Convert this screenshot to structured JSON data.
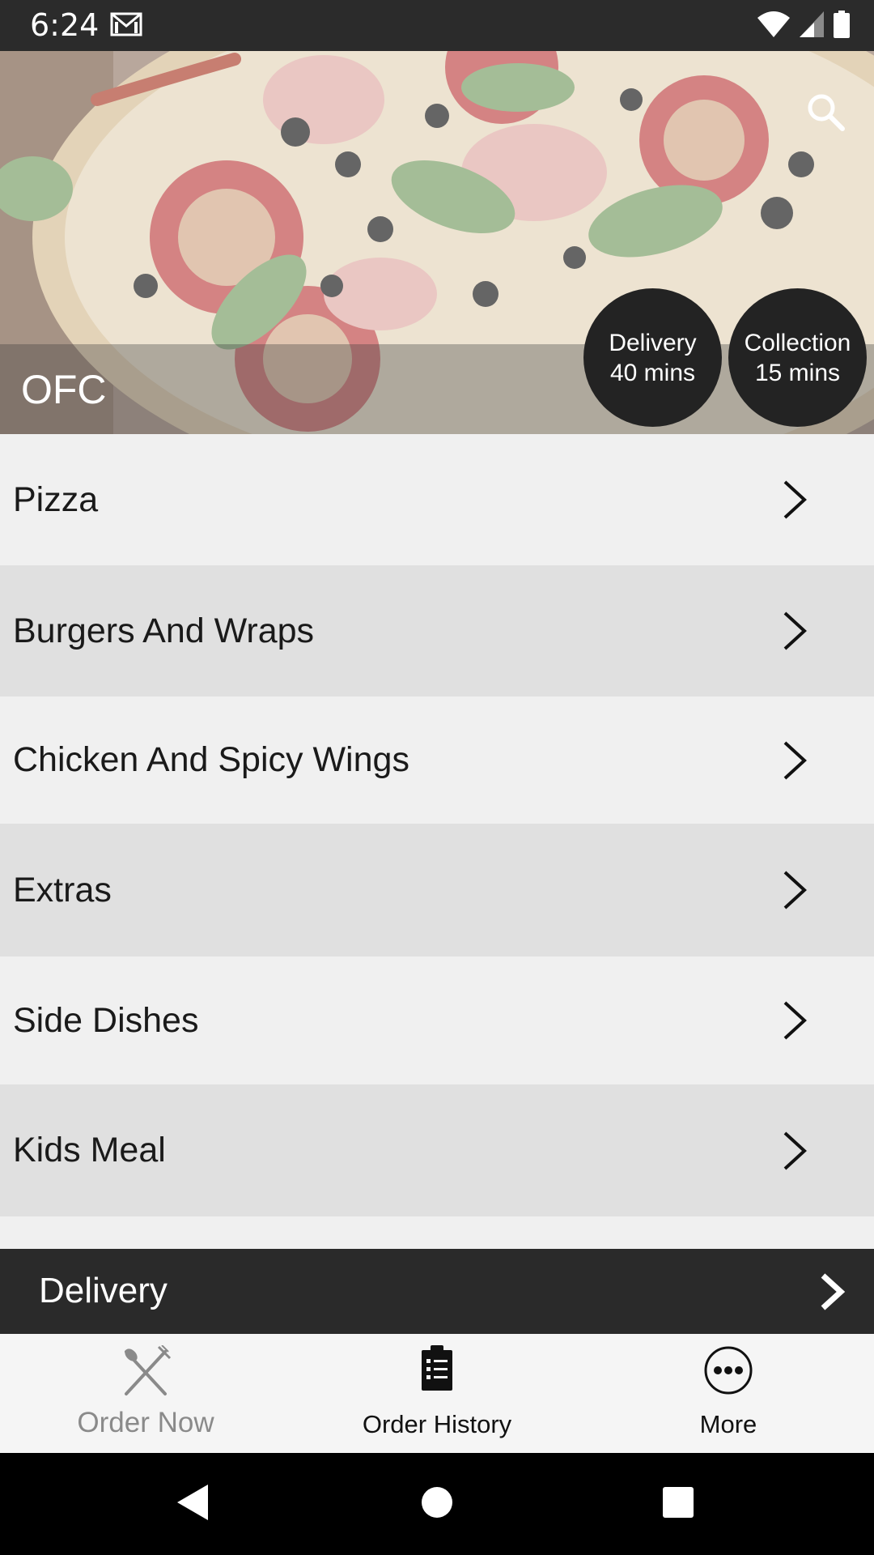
{
  "status_bar": {
    "time": "6:24",
    "icons": [
      "gmail-icon",
      "wifi-icon",
      "signal-icon",
      "battery-icon"
    ]
  },
  "header": {
    "title": "OFC",
    "search_icon": "search-icon",
    "delivery_label": "Delivery",
    "delivery_time": "40 mins",
    "collection_label": "Collection",
    "collection_time": "15 mins"
  },
  "menu": {
    "items": [
      {
        "label": "Pizza"
      },
      {
        "label": "Burgers And Wraps"
      },
      {
        "label": "Chicken And Spicy Wings"
      },
      {
        "label": "Extras"
      },
      {
        "label": "Side Dishes"
      },
      {
        "label": "Kids Meal"
      }
    ]
  },
  "delivery_bar": {
    "label": "Delivery"
  },
  "bottom_nav": {
    "items": [
      {
        "label": "Order Now",
        "icon": "fork-knife-icon",
        "active": true
      },
      {
        "label": "Order History",
        "icon": "clipboard-list-icon",
        "active": false
      },
      {
        "label": "More",
        "icon": "more-dots-icon",
        "active": false
      }
    ]
  },
  "colors": {
    "status_bar": "#2b2b2b",
    "list_light": "#f0f0f0",
    "list_dark": "#e0e0e0",
    "bubble": "#232323",
    "delivery_bar": "#2a2a2a",
    "nav_inactive_label": "#8a8a8a"
  }
}
